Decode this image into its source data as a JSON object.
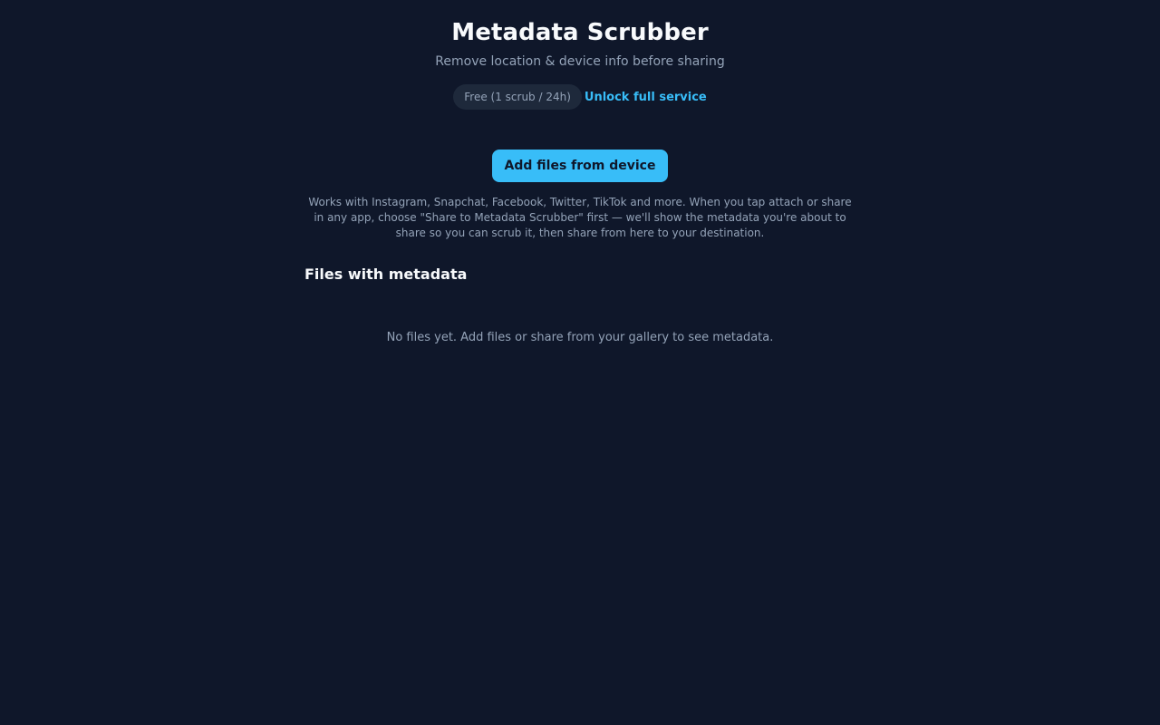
{
  "app": {
    "title": "Metadata Scrubber",
    "subtitle": "Remove location & device info before sharing"
  },
  "plan": {
    "badge": "Free (1 scrub / 24h)",
    "unlock_label": "Unlock full service"
  },
  "actions": {
    "add_files_label": "Add files from device"
  },
  "help": {
    "text": "Works with Instagram, Snapchat, Facebook, Twitter, TikTok and more. When you tap attach or share in any app, choose \"Share to Metadata Scrubber\" first — we'll show the metadata you're about to share so you can scrub it, then share from here to your destination."
  },
  "files": {
    "section_title": "Files with metadata",
    "empty_message": "No files yet. Add files or share from your gallery to see metadata."
  },
  "colors": {
    "background": "#0f172a",
    "accent": "#38bdf8",
    "badge_background": "#1e293b",
    "muted_text": "#94a3b8",
    "heading_text": "#f8fafc"
  }
}
